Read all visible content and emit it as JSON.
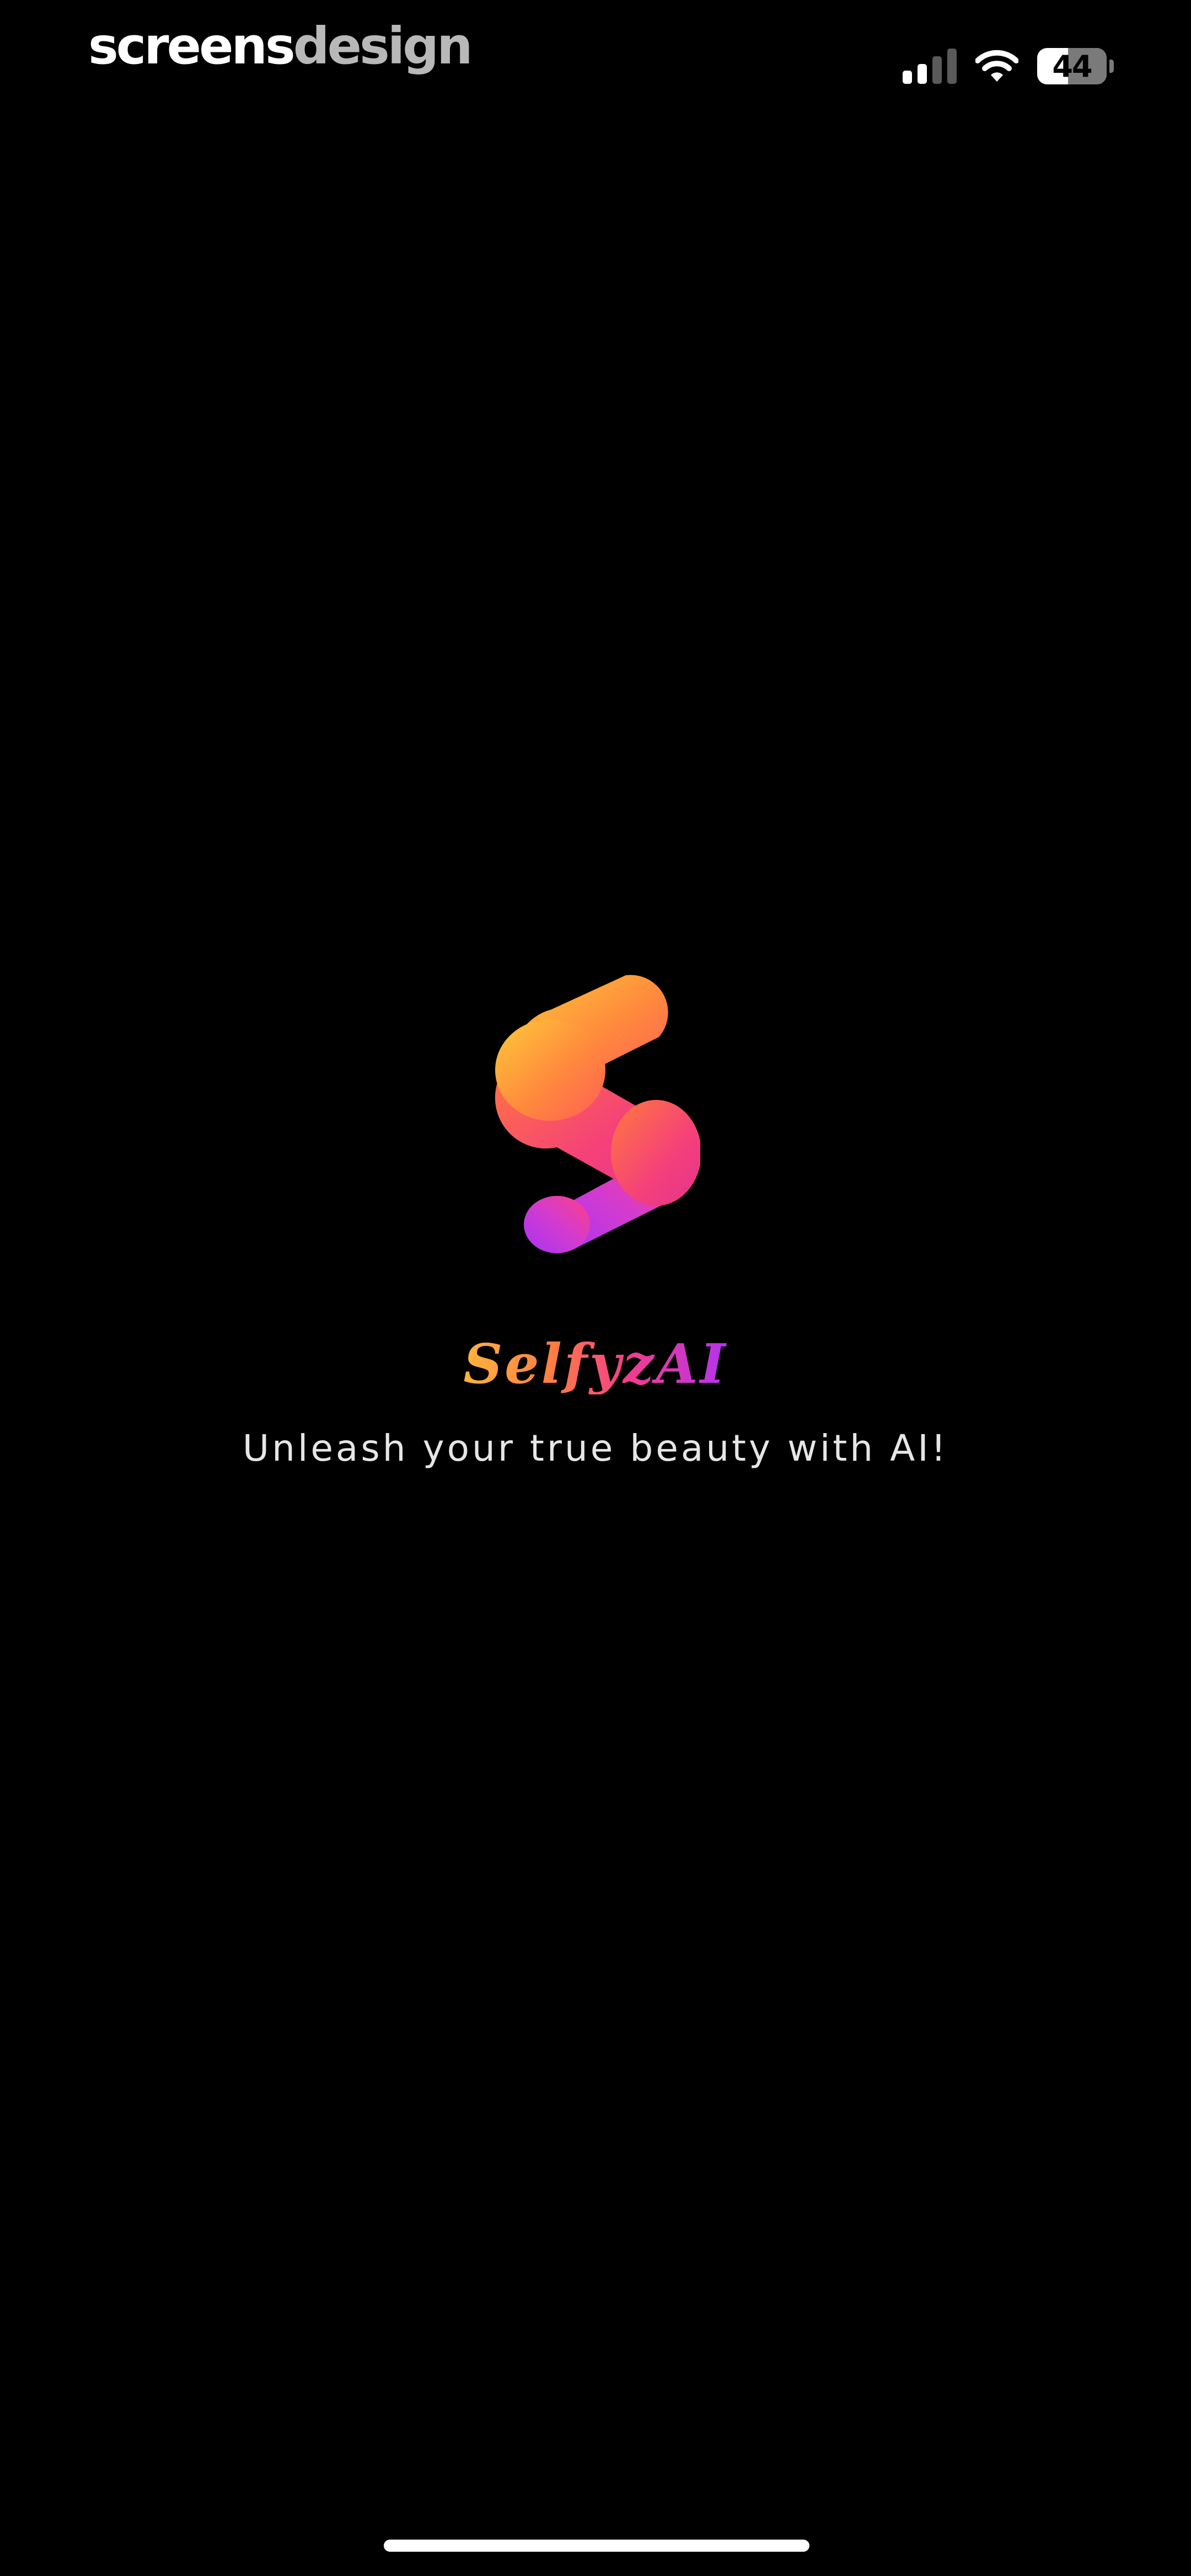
{
  "watermark": {
    "part1": "screens",
    "part2": "design"
  },
  "status_bar": {
    "signal_icon": "cellular-signal-icon",
    "wifi_icon": "wifi-icon",
    "battery_level": "44",
    "battery_icon": "battery-icon"
  },
  "splash": {
    "logo_icon": "selfyzai-s-logo-icon",
    "app_name": "SelfyzAI",
    "tagline": "Unleash your true beauty with AI!"
  },
  "colors": {
    "background": "#000000",
    "logo_orange": "#ffb43c",
    "logo_pink": "#f23d8c",
    "logo_purple": "#b433f0",
    "tagline": "#e6e6e6"
  }
}
